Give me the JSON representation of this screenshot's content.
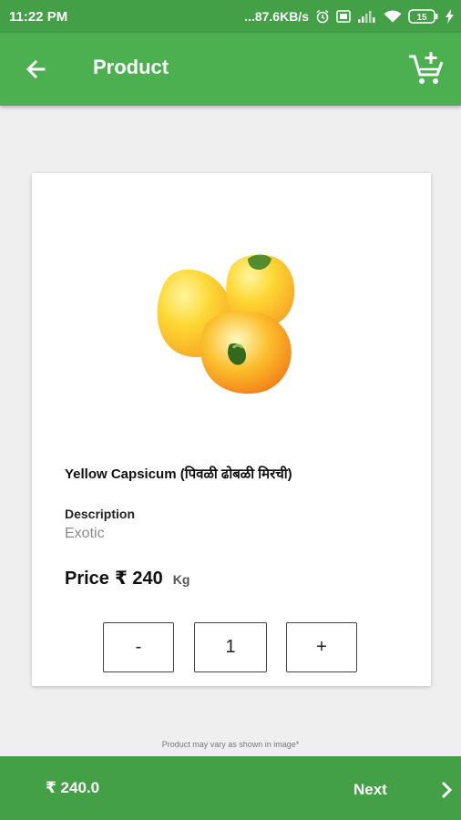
{
  "status_bar": {
    "time": "11:22 PM",
    "network_speed": "...87.6KB/s",
    "battery": "15",
    "icons": [
      "alarm-icon",
      "sim-icon",
      "signal-icon",
      "wifi-icon",
      "battery-icon",
      "charging-icon"
    ]
  },
  "app_bar": {
    "title": "Product",
    "back_icon": "arrow-left-icon",
    "cart_icon": "cart-add-icon"
  },
  "product": {
    "image": "yellow-capsicum-image",
    "name": "Yellow Capsicum (पिवळी ढोबळी मिरची)",
    "description_label": "Description",
    "description": "Exotic",
    "price_label": "Price",
    "price": "₹ 240",
    "unit": "Kg",
    "quantity": "1",
    "decrement_label": "-",
    "increment_label": "+"
  },
  "disclaimer": "Product may vary as shown in image*",
  "bottom_bar": {
    "total": "₹ 240.0",
    "next_label": "Next",
    "next_icon": "chevron-right-icon"
  },
  "colors": {
    "primary": "#4caf50",
    "primary_dark": "#43a047",
    "background": "#efeff0"
  }
}
